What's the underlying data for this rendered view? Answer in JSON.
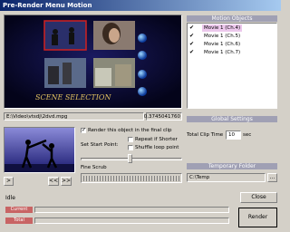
{
  "window": {
    "title": "Pre-Render Menu Motion"
  },
  "preview": {
    "scene_caption": "SCENE SELECTION"
  },
  "file_path": "E:\\Video\\vtsdj\\2dvd.mpg",
  "time_readout": "0.3745041760",
  "motion_objects": {
    "header": "Motion Objects",
    "items": [
      {
        "label": "Movie 1 (Ch.4)",
        "checked": true,
        "selected": true
      },
      {
        "label": "Movie 1 (Ch.5)",
        "checked": true,
        "selected": false
      },
      {
        "label": "Movie 1 (Ch.6)",
        "checked": true,
        "selected": false
      },
      {
        "label": "Movie 1 (Ch.7)",
        "checked": true,
        "selected": false
      }
    ]
  },
  "options": {
    "render_label": "Render this object in the final clip",
    "set_start_point_label": "Set Start Point:",
    "repeat_label": "Repeat if Shorter",
    "shuffle_label": "Shuffle loop point",
    "fine_scrub_label": "Fine Scrub"
  },
  "transport": {
    "play_label": ">",
    "back_label": "<<",
    "forward_label": ">>"
  },
  "global_settings": {
    "header": "Global Settings",
    "total_clip_time_label": "Total Clip Time",
    "total_clip_time_value": "10",
    "unit": "sec"
  },
  "temporary_folder": {
    "header": "Temporary Folder",
    "path": "C:\\Temp",
    "browse_label": "..."
  },
  "status": {
    "idle_label": "Idle",
    "current_label": "Current",
    "total_label": "Total",
    "current_progress": 0,
    "total_progress": 0
  },
  "buttons": {
    "close_label": "Close",
    "render_label": "Render"
  },
  "colors": {
    "title_bar": "#0a246a",
    "panel_header": "#a0a0b4",
    "selected_item": "#ecc8ec",
    "progress_label": "#c86464"
  }
}
